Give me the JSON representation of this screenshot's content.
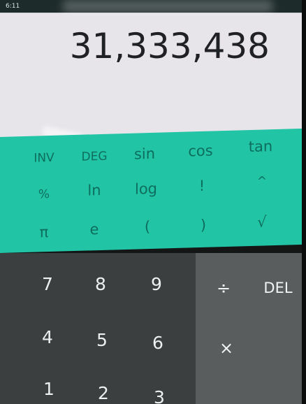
{
  "status_bar": {
    "time": "6:11"
  },
  "display": {
    "value": "31,333,438"
  },
  "advanced": {
    "row1": [
      "INV",
      "DEG",
      "sin",
      "cos",
      "tan"
    ],
    "row2": [
      "%",
      "ln",
      "log",
      "!",
      "^"
    ],
    "row3": [
      "π",
      "e",
      "(",
      ")",
      "√"
    ]
  },
  "numpad": {
    "row1": [
      "7",
      "8",
      "9"
    ],
    "row2": [
      "4",
      "5",
      "6"
    ],
    "row3": [
      "1",
      "2",
      "3"
    ]
  },
  "operators": {
    "divide": "÷",
    "delete": "DEL",
    "multiply": "×"
  },
  "colors": {
    "display_bg": "#e8e5ea",
    "advanced_bg": "#22c4a6",
    "advanced_text": "#0e6e5d",
    "numpad_bg": "#3c3f3f",
    "ops_bg": "#5a5d5d"
  }
}
